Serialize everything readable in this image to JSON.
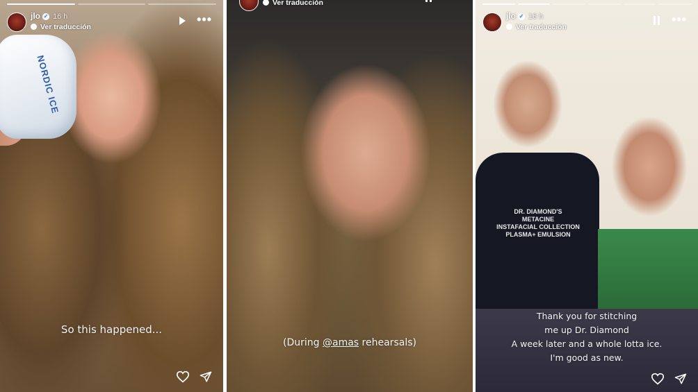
{
  "stories": [
    {
      "username": "jlo",
      "time": "16 h",
      "translate_label": "Ver traducción",
      "caption": "So this happened...",
      "cold_pack_text": "NORDIC ICE"
    },
    {
      "translate_label": "Ver traducción",
      "caption_prefix": "(During ",
      "caption_mention": "@amas",
      "caption_suffix": " rehearsals)"
    },
    {
      "username": "jlo",
      "time": "16 h",
      "translate_label": "Ver traducción",
      "caption_lines": [
        "Thank you for stitching",
        "me up Dr. Diamond",
        "A week later and a whole lotta ice.",
        "I'm good as new."
      ],
      "shirt_lines": [
        "DR. DIAMOND'S",
        "METACINE",
        "INSTAFACIAL COLLECTION",
        "PLASMA+ EMULSION"
      ]
    }
  ],
  "icons": {
    "like": "heart-icon",
    "share": "send-icon",
    "more": "more-icon",
    "play": "play-icon",
    "pause": "pause-icon",
    "verified": "verified-icon"
  },
  "colors": {
    "verified": "#3897f0",
    "text": "#ffffff"
  }
}
